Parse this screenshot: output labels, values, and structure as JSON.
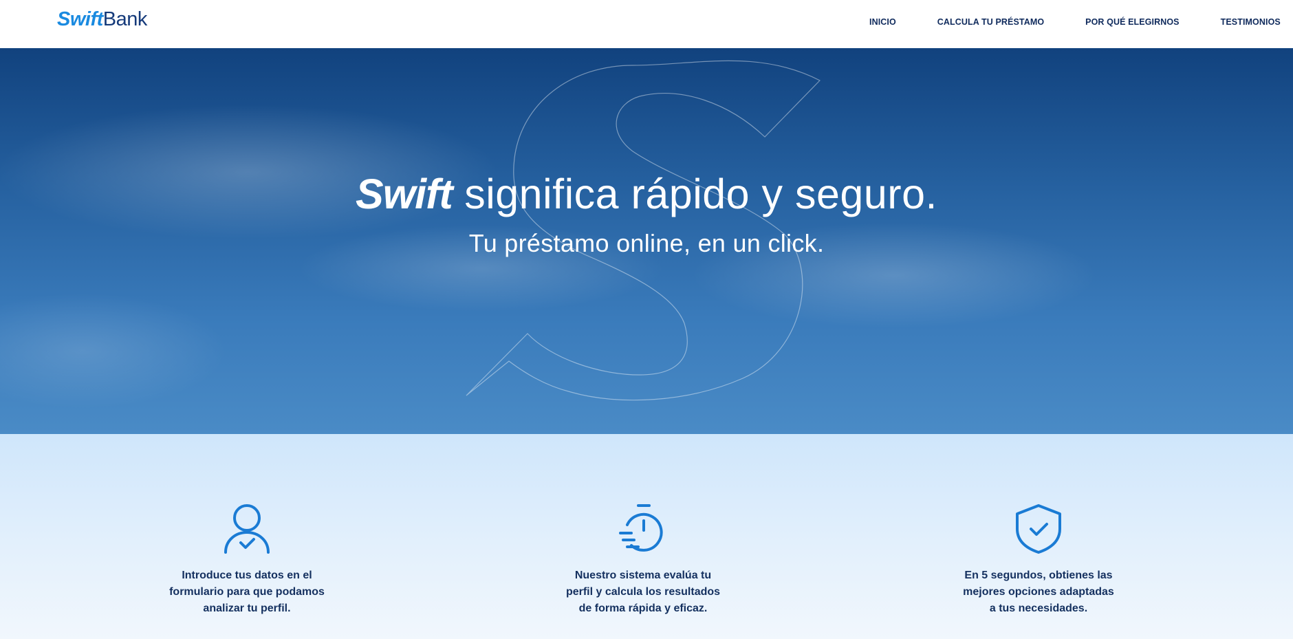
{
  "header": {
    "logo": {
      "swift": "Swift",
      "bank": "Bank"
    },
    "nav": [
      "INICIO",
      "CALCULA TU PRÉSTAMO",
      "POR QUÉ ELEGIRNOS",
      "TESTIMONIOS"
    ]
  },
  "hero": {
    "title_brand": "Swift",
    "title_rest": " significa rápido y seguro.",
    "subtitle": "Tu préstamo online, en un click."
  },
  "features": [
    {
      "icon": "user-check-icon",
      "lines": [
        "Introduce tus datos en el",
        "formulario para que podamos",
        "analizar tu perfil."
      ]
    },
    {
      "icon": "stopwatch-icon",
      "lines": [
        "Nuestro sistema evalúa tu",
        "perfil y calcula los resultados",
        "de forma rápida y eficaz."
      ]
    },
    {
      "icon": "shield-check-icon",
      "lines": [
        "En 5 segundos, obtienes las",
        "mejores opciones adaptadas",
        "a tus necesidades."
      ]
    }
  ],
  "colors": {
    "brand_light": "#1a8ae0",
    "brand_dark": "#153a7a",
    "nav_text": "#0f2a5c",
    "icon": "#1a7bd4",
    "features_bg": "#d6eafc"
  }
}
